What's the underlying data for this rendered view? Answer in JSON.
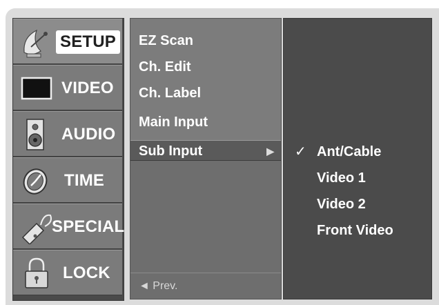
{
  "menu": {
    "categories": [
      {
        "label": "SETUP",
        "icon": "satellite-dish-icon"
      },
      {
        "label": "VIDEO",
        "icon": "tv-screen-icon"
      },
      {
        "label": "AUDIO",
        "icon": "speaker-icon"
      },
      {
        "label": "TIME",
        "icon": "clock-icon"
      },
      {
        "label": "SPECIAL",
        "icon": "tag-key-icon"
      },
      {
        "label": "LOCK",
        "icon": "padlock-icon"
      }
    ],
    "active_category": "SETUP"
  },
  "submenu": {
    "items": [
      "EZ Scan",
      "Ch. Edit",
      "Ch. Label",
      "Main Input",
      "Sub Input"
    ],
    "selected": "Sub Input",
    "selected_arrow": "▶",
    "prev_label": "◄ Prev."
  },
  "options": {
    "items": [
      "Ant/Cable",
      "Video 1",
      "Video 2",
      "Front Video"
    ],
    "checked": "Ant/Cable",
    "check_mark": "✓"
  },
  "colors": {
    "panel_bg": "#dcdcdc",
    "menu_dark": "#4a4a4a",
    "menu_tile": "#7b7b7b",
    "text": "#ffffff"
  }
}
